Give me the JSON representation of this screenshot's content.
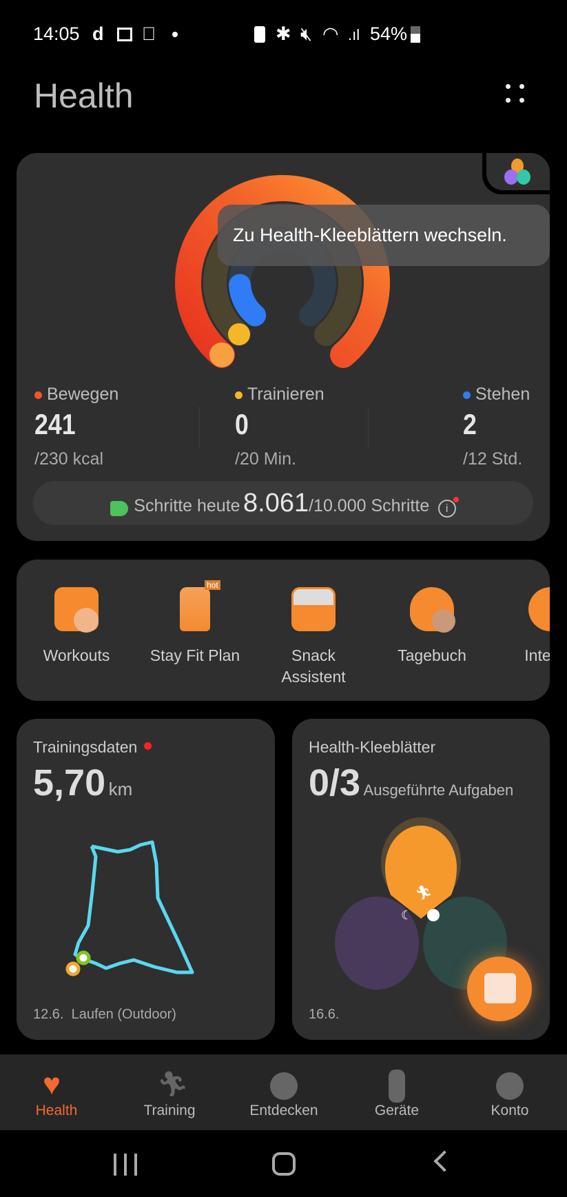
{
  "status_bar": {
    "time": "14:05",
    "battery": "54%"
  },
  "header": {
    "title": "Health",
    "menu_icon": "more-dots-icon"
  },
  "activity": {
    "tooltip": "Zu Health-Kleeblättern wechseln.",
    "stats": [
      {
        "label": "Bewegen",
        "value": "241",
        "goal": "/230 kcal",
        "color": "#f0552b",
        "progress": 1.0
      },
      {
        "label": "Trainieren",
        "value": "0",
        "goal": "/20 Min.",
        "color": "#f5b72a",
        "progress": 0
      },
      {
        "label": "Stehen",
        "value": "2",
        "goal": "/12 Std.",
        "color": "#2f7cf6",
        "progress": 0.1667
      }
    ],
    "steps": {
      "label": "Schritte heute",
      "value": "8.061",
      "goal": "/10.000 Schritte"
    }
  },
  "shortcuts": [
    {
      "label": "Workouts"
    },
    {
      "label": "Stay Fit Plan",
      "badge": "hot"
    },
    {
      "label": "Snack",
      "label2": "Assistent"
    },
    {
      "label": "Tagebuch"
    },
    {
      "label": "Interval"
    }
  ],
  "training_card": {
    "title": "Trainingsdaten",
    "value": "5,70",
    "unit": "km",
    "footer": "12.6.  Laufen (Outdoor)",
    "route_color": "#5ad8ee"
  },
  "clover_card": {
    "title": "Health-Kleeblätter",
    "value": "0/3",
    "unit": "Ausgeführte Aufgaben",
    "footer": "16.6."
  },
  "bottom_nav": [
    {
      "label": "Health",
      "active": true
    },
    {
      "label": "Training"
    },
    {
      "label": "Entdecken"
    },
    {
      "label": "Geräte"
    },
    {
      "label": "Konto"
    }
  ],
  "accent": "#f26a2e"
}
